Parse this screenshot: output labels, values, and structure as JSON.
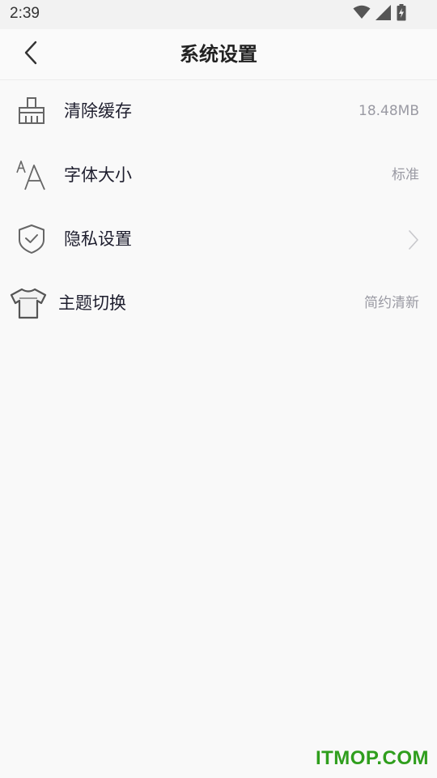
{
  "status_bar": {
    "time": "2:39",
    "icons": [
      "wifi-icon",
      "cell-signal-icon",
      "battery-charging-icon"
    ]
  },
  "app_bar": {
    "back_icon": "chevron-left-icon",
    "title": "系统设置"
  },
  "settings": {
    "items": [
      {
        "label": "清除缓存",
        "value": "18.48MB",
        "icon": "broom-icon"
      },
      {
        "label": "字体大小",
        "value": "标准",
        "icon": "font-size-icon"
      },
      {
        "label": "隐私设置",
        "value": "",
        "icon": "shield-check-icon",
        "trailing": "chevron-right-icon"
      },
      {
        "label": "主题切换",
        "value": "简约清新",
        "icon": "tshirt-icon"
      }
    ]
  },
  "watermark": "ITMOP.COM",
  "colors": {
    "background": "#f9f9f9",
    "status_bar": "#f2f2f2",
    "title_text": "#222222",
    "secondary_text": "#9a9aa3",
    "icon_gray": "#666666",
    "watermark_green": "#2f9e1d"
  }
}
